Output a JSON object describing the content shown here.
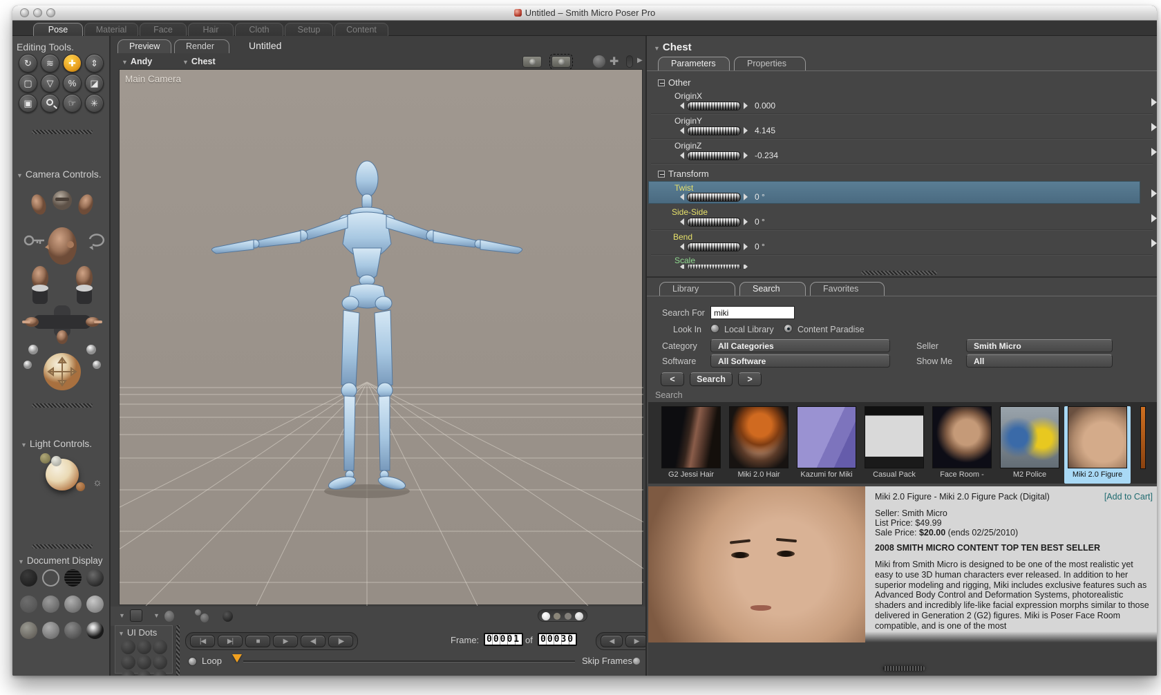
{
  "window": {
    "title": "Untitled – Smith Micro Poser Pro"
  },
  "main_tabs": {
    "items": [
      "Pose",
      "Material",
      "Face",
      "Hair",
      "Cloth",
      "Setup",
      "Content"
    ],
    "active": "Pose"
  },
  "icons": {
    "disclosure": "▼",
    "arrow_right": "▶",
    "sun": "☼",
    "cross": "✚",
    "play": "▶",
    "stop": "■",
    "first_frame": "|◀",
    "last_frame": "▶|",
    "step_back": "◀|",
    "step_forward": "|▶",
    "prev": "◀",
    "next": "▶",
    "plus": "+",
    "minus": "−"
  },
  "sidebar": {
    "editing_tools": {
      "title": "Editing Tools.",
      "tools": [
        {
          "name": "rotate",
          "glyph": "↻"
        },
        {
          "name": "twist",
          "glyph": "≋"
        },
        {
          "name": "translate",
          "glyph": "✚"
        },
        {
          "name": "translate-in-out",
          "glyph": "⇕"
        },
        {
          "name": "scale",
          "glyph": "▢"
        },
        {
          "name": "taper",
          "glyph": "▽"
        },
        {
          "name": "chain-break",
          "glyph": "%"
        },
        {
          "name": "color",
          "glyph": "◪"
        },
        {
          "name": "grouping",
          "glyph": "▣"
        },
        {
          "name": "view-magnifier",
          "glyph": ""
        },
        {
          "name": "morphing-tool",
          "glyph": "☞"
        },
        {
          "name": "direct-manipulation",
          "glyph": "✳"
        }
      ]
    },
    "camera_controls": {
      "title": "Camera Controls."
    },
    "light_controls": {
      "title": "Light Controls."
    },
    "document_display": {
      "title": "Document Display"
    }
  },
  "document": {
    "tabs": {
      "preview": "Preview",
      "render": "Render"
    },
    "name": "Untitled",
    "actor": "Andy",
    "element": "Chest",
    "camera": "Main Camera"
  },
  "ui_dots": {
    "title": "UI Dots"
  },
  "animation": {
    "frame_label": "Frame:",
    "current": "00001",
    "of_label": "of",
    "total": "00030",
    "loop": "Loop",
    "skip_frames": "Skip Frames"
  },
  "parameters": {
    "header": "Chest",
    "tabs": [
      "Parameters",
      "Properties"
    ],
    "groups": [
      {
        "title": "Other",
        "rows": [
          {
            "label": "OriginX",
            "value": "0.000"
          },
          {
            "label": "OriginY",
            "value": "4.145"
          },
          {
            "label": "OriginZ",
            "value": "-0.234"
          }
        ]
      },
      {
        "title": "Transform",
        "rows": [
          {
            "label": "Twist",
            "value": "0 °",
            "selected": true
          },
          {
            "label": "Side-Side",
            "value": "0 °"
          },
          {
            "label": "Bend",
            "value": "0 °"
          },
          {
            "label": "Scale",
            "value": ""
          }
        ]
      }
    ]
  },
  "library": {
    "tabs": [
      "Library",
      "Search",
      "Favorites"
    ],
    "active": "Search",
    "form": {
      "search_for_label": "Search For",
      "search_value": "miki",
      "look_in_label": "Look In",
      "radio_local": "Local Library",
      "radio_paradise": "Content Paradise",
      "selected_radio": "Content Paradise",
      "category_label": "Category",
      "category_value": "All Categories",
      "seller_label": "Seller",
      "seller_value": "Smith Micro",
      "software_label": "Software",
      "software_value": "All Software",
      "show_me_label": "Show Me",
      "show_me_value": "All",
      "prev": "<",
      "search_button": "Search",
      "next": ">"
    },
    "results_label": "Search",
    "results": [
      {
        "label": "G2 Jessi Hair"
      },
      {
        "label": "Miki 2.0 Hair"
      },
      {
        "label": "Kazumi for Miki"
      },
      {
        "label": "Casual Pack"
      },
      {
        "label": "Face Room -"
      },
      {
        "label": "M2 Police"
      },
      {
        "label": "Miki 2.0 Figure",
        "selected": true
      }
    ]
  },
  "product": {
    "title": "Miki 2.0 Figure - Miki 2.0 Figure Pack (Digital)",
    "add_to_cart": "[Add to Cart]",
    "seller": "Seller: Smith Micro",
    "list_price": "List Price: $49.99",
    "sale_price_label": "Sale Price:",
    "sale_price": "$20.00",
    "sale_suffix": "(ends 02/25/2010)",
    "banner": "2008 SMITH MICRO CONTENT TOP TEN BEST SELLER",
    "description": "Miki from Smith Micro is designed to be one of the most realistic yet easy to use 3D human characters ever released. In addition to her superior modeling and rigging, Miki includes exclusive features such as Advanced Body Control and Deformation Systems, photorealistic shaders and incredibly life-like facial expression morphs similar to those delivered in Generation 2 (G2) figures. Miki is Poser Face Room compatible, and is one of the most"
  },
  "colors": {
    "accent_orange": "#e8a020",
    "selection_blue": "#4f7289",
    "label_yellow": "#e6e06a",
    "label_green": "#8fd98f",
    "selected_thumb": "#a9d9f5",
    "link_teal": "#1f6b70"
  }
}
